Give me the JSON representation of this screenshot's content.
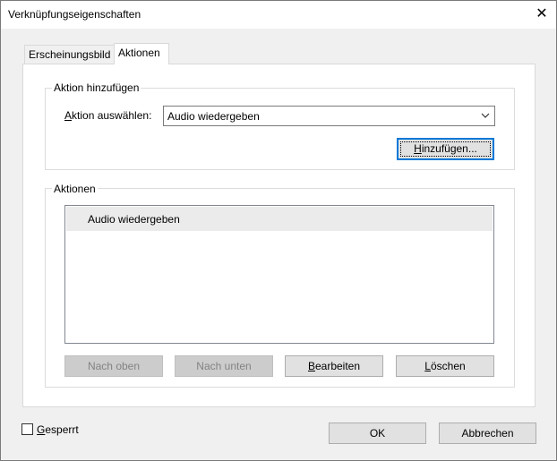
{
  "window": {
    "title": "Verknüpfungseigenschaften",
    "close_glyph": "✕"
  },
  "tabs": [
    {
      "label": "Erscheinungsbild",
      "active": false
    },
    {
      "label": "Aktionen",
      "active": true
    }
  ],
  "add_action": {
    "legend": "Aktion hinzufügen",
    "select_label_pre": "",
    "select_label_u": "A",
    "select_label_post": "ktion auswählen:",
    "select_value": "Audio wiedergeben",
    "add_button_u": "H",
    "add_button_post": "inzufügen..."
  },
  "actions": {
    "legend": "Aktionen",
    "items": [
      "Audio wiedergeben"
    ],
    "buttons": {
      "up": "Nach oben",
      "down": "Nach unten",
      "edit_u": "B",
      "edit_post": "earbeiten",
      "delete_u": "L",
      "delete_post": "öschen"
    }
  },
  "footer": {
    "locked_u": "G",
    "locked_post": "esperrt",
    "ok": "OK",
    "cancel": "Abbrechen"
  },
  "colors": {
    "focus_border": "#0078d7",
    "panel_bg": "#ffffff",
    "window_bg": "#f0f0f0"
  },
  "icons": {
    "close": "close-icon",
    "dropdown": "chevron-down-icon"
  }
}
